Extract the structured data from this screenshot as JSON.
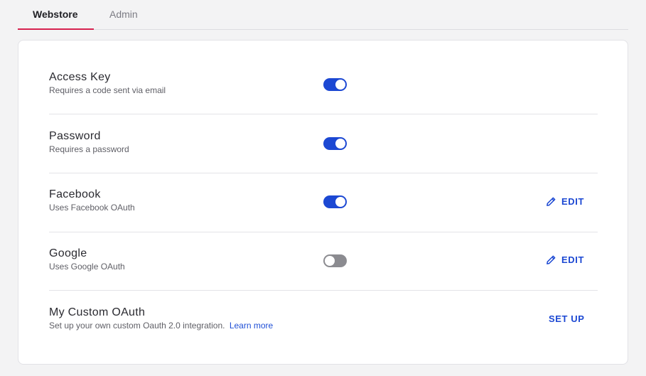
{
  "tabs": [
    {
      "label": "Webstore",
      "active": true
    },
    {
      "label": "Admin",
      "active": false
    }
  ],
  "colors": {
    "accent": "#1c48d3",
    "tab_underline": "#d6214f",
    "toggle_off": "#8b8b90"
  },
  "methods": [
    {
      "title": "Access Key",
      "description": "Requires a code sent via email",
      "enabled": true
    },
    {
      "title": "Password",
      "description": "Requires a password",
      "enabled": true
    },
    {
      "title": "Facebook",
      "description": "Uses Facebook OAuth",
      "enabled": true,
      "action_label": "EDIT",
      "action_icon": "pencil-icon"
    },
    {
      "title": "Google",
      "description": "Uses Google OAuth",
      "enabled": false,
      "action_label": "EDIT",
      "action_icon": "pencil-icon"
    },
    {
      "title": "My Custom OAuth",
      "description": "Set up your own custom Oauth 2.0 integration.",
      "link_text": "Learn more",
      "action_label": "SET UP"
    }
  ]
}
